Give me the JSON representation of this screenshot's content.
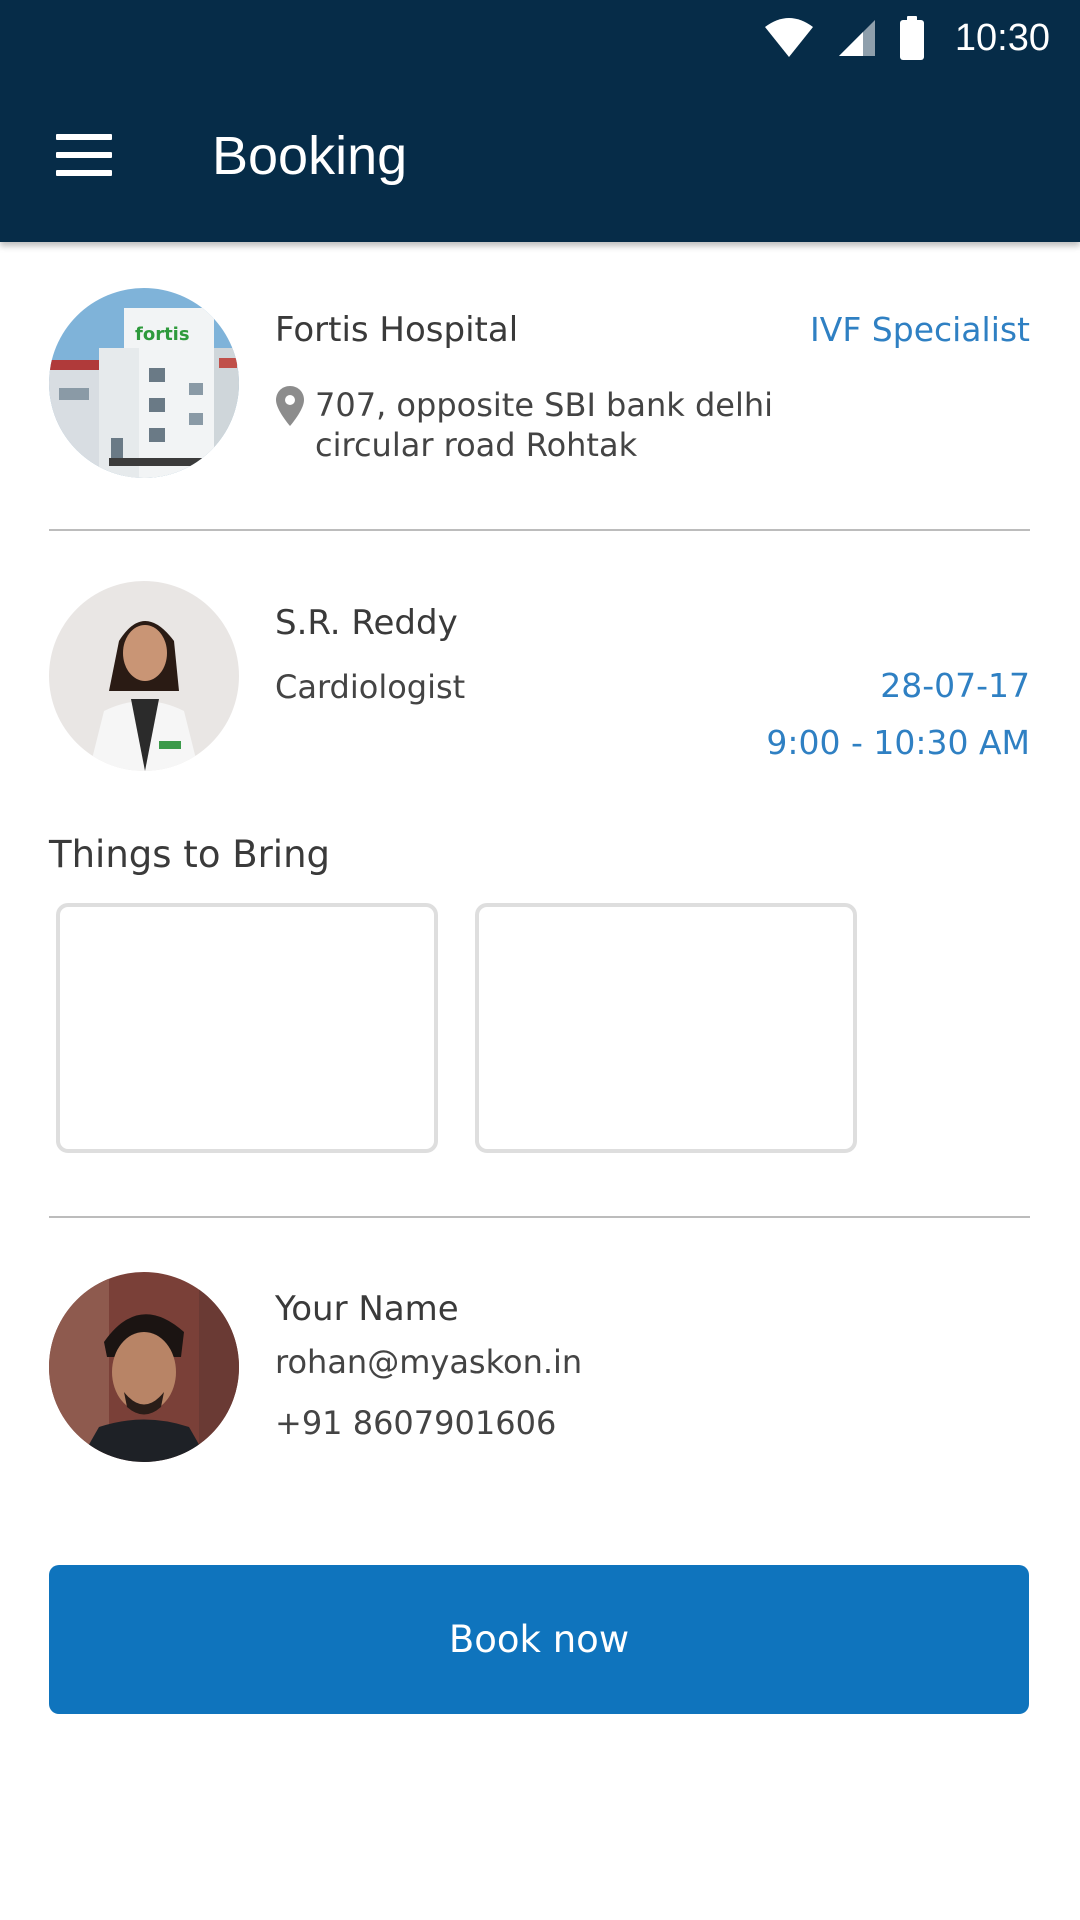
{
  "status_bar": {
    "time": "10:30",
    "icons": [
      "wifi-icon",
      "signal-icon",
      "battery-icon"
    ]
  },
  "appbar": {
    "title": "Booking",
    "menu_icon": "menu-icon"
  },
  "hospital": {
    "name": "Fortis Hospital",
    "specialty": "IVF Specialist",
    "address_line1": "707, opposite SBI bank delhi",
    "address_line2": "circular road Rohtak",
    "location_icon": "location-pin-icon"
  },
  "doctor": {
    "name": "S.R. Reddy",
    "role": "Cardiologist",
    "date": "28-07-17",
    "time": "9:00 - 10:30 AM"
  },
  "things_to_bring": {
    "title": "Things to Bring",
    "items": [
      "",
      ""
    ]
  },
  "user": {
    "name": "Your Name",
    "email": "rohan@myaskon.in",
    "phone": "+91 8607901606"
  },
  "actions": {
    "book_label": "Book now"
  },
  "colors": {
    "appbar": "#062c48",
    "accent_text": "#2f80c3",
    "button": "#0f74bd"
  }
}
